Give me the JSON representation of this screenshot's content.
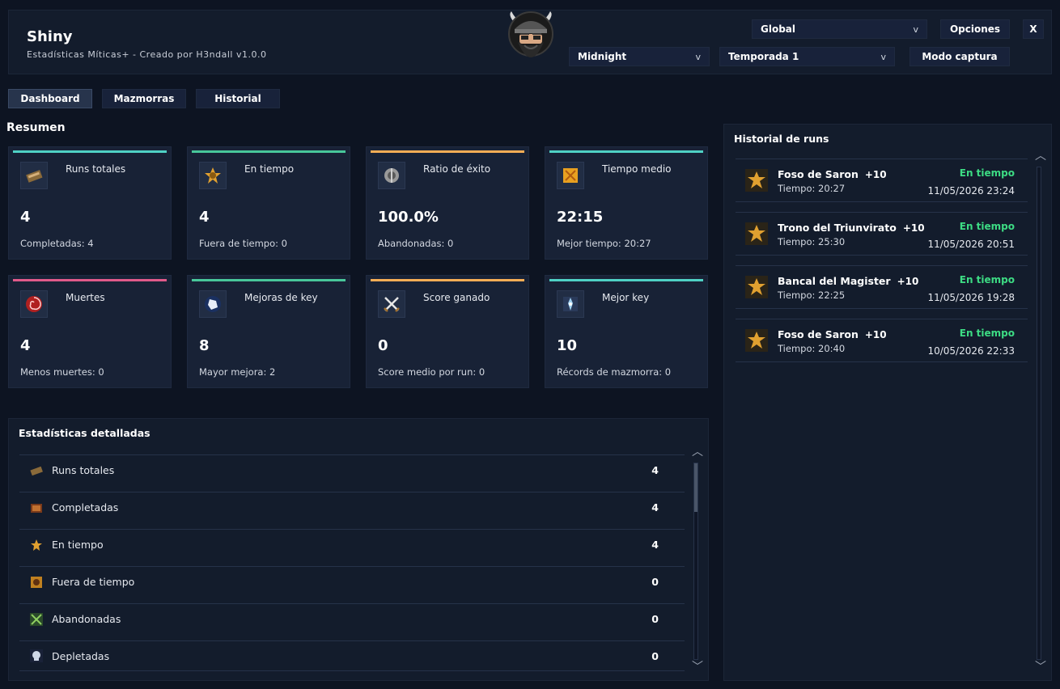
{
  "header": {
    "title": "Shiny",
    "subtitle": "Estadísticas Míticas+ - Creado por H3ndall v1.0.0",
    "scope_select": "Global",
    "options_label": "Opciones",
    "close_label": "X",
    "expansion_select": "Midnight",
    "season_select": "Temporada 1",
    "capture_label": "Modo captura",
    "chevron": "v"
  },
  "tabs": [
    "Dashboard",
    "Mazmorras",
    "Historial"
  ],
  "summary": {
    "title": "Resumen",
    "cards": [
      {
        "label": "Runs totales",
        "value": "4",
        "sub": "Completadas: 4",
        "accent": "#4fd1c5",
        "icon": "box-icon"
      },
      {
        "label": "En tiempo",
        "value": "4",
        "sub": "Fuera de tiempo: 0",
        "accent": "#48c79a",
        "icon": "gold-emblem-icon"
      },
      {
        "label": "Ratio de éxito",
        "value": "100.0%",
        "sub": "Abandonadas: 0",
        "accent": "#f6ad55",
        "icon": "shield-icon"
      },
      {
        "label": "Tiempo medio",
        "value": "22:15",
        "sub": "Mejor tiempo: 20:27",
        "accent": "#4fd1c5",
        "icon": "hourglass-icon"
      },
      {
        "label": "Muertes",
        "value": "4",
        "sub": "Menos muertes: 0",
        "accent": "#e05a8a",
        "icon": "vortex-icon"
      },
      {
        "label": "Mejoras de key",
        "value": "8",
        "sub": "Mayor mejora: 2",
        "accent": "#48c79a",
        "icon": "crystal-icon"
      },
      {
        "label": "Score ganado",
        "value": "0",
        "sub": "Score medio por run: 0",
        "accent": "#f6ad55",
        "icon": "crossed-swords-icon"
      },
      {
        "label": "Mejor key",
        "value": "10",
        "sub": "Récords de mazmorra: 0",
        "accent": "#4fd1c5",
        "icon": "key-icon"
      }
    ]
  },
  "details": {
    "title": "Estadísticas detalladas",
    "rows": [
      {
        "label": "Runs totales",
        "value": "4",
        "icon": "box-icon"
      },
      {
        "label": "Completadas",
        "value": "4",
        "icon": "chest-icon"
      },
      {
        "label": "En tiempo",
        "value": "4",
        "icon": "gold-emblem-icon"
      },
      {
        "label": "Fuera de tiempo",
        "value": "0",
        "icon": "clock-icon"
      },
      {
        "label": "Abandonadas",
        "value": "0",
        "icon": "crossed-swords-icon"
      },
      {
        "label": "Depletadas",
        "value": "0",
        "icon": "skull-icon"
      }
    ]
  },
  "history": {
    "title": "Historial de runs",
    "runs": [
      {
        "name": "Foso de Saron",
        "level": "+10",
        "time": "Tiempo: 20:27",
        "status": "En tiempo",
        "date": "11/05/2026 23:24"
      },
      {
        "name": "Trono del Triunvirato",
        "level": "+10",
        "time": "Tiempo: 25:30",
        "status": "En tiempo",
        "date": "11/05/2026 20:51"
      },
      {
        "name": "Bancal del Magister",
        "level": "+10",
        "time": "Tiempo: 22:25",
        "status": "En tiempo",
        "date": "11/05/2026 19:28"
      },
      {
        "name": "Foso de Saron",
        "level": "+10",
        "time": "Tiempo: 20:40",
        "status": "En tiempo",
        "date": "10/05/2026 22:33"
      }
    ]
  }
}
